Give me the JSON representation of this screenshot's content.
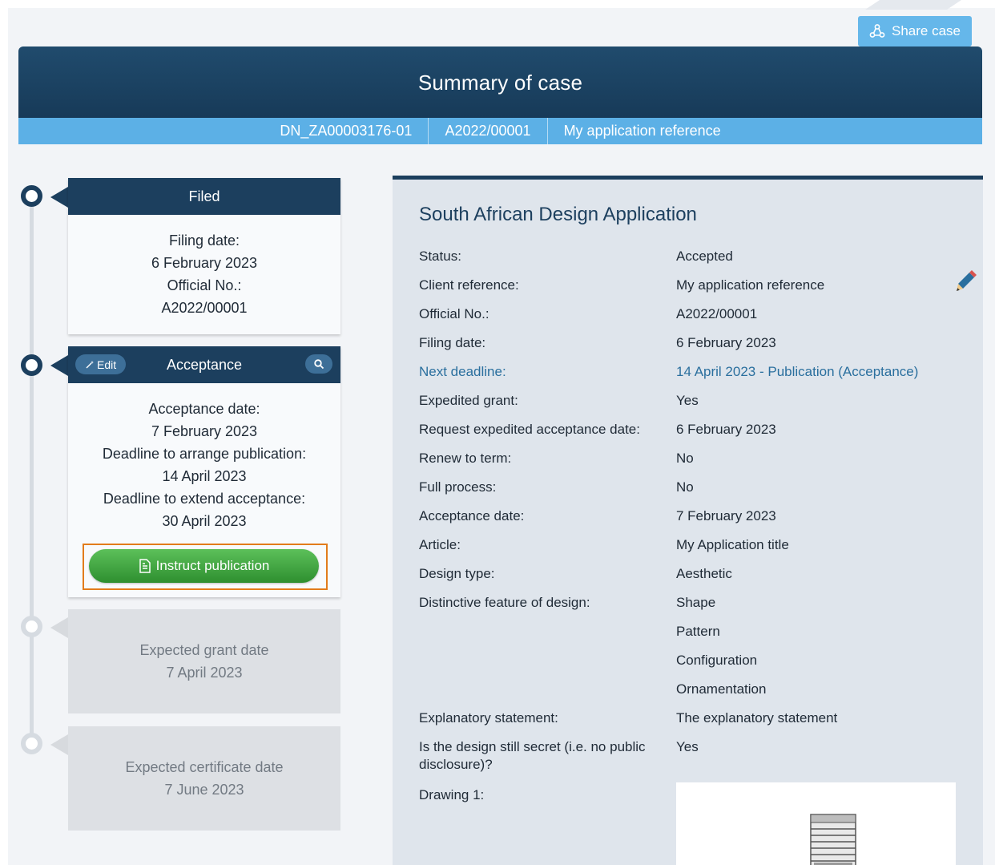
{
  "share_button": {
    "label": "Share case",
    "icon": "share-icon"
  },
  "header": {
    "title": "Summary of case",
    "strip": [
      "DN_ZA00003176-01",
      "A2022/00001",
      "My application reference"
    ]
  },
  "timeline": {
    "filed": {
      "title": "Filed",
      "lines": [
        "Filing date:",
        "6 February 2023",
        "Official No.:",
        "A2022/00001"
      ]
    },
    "acceptance": {
      "title": "Acceptance",
      "edit_label": "Edit",
      "lines": [
        "Acceptance date:",
        "7 February 2023",
        "Deadline to arrange publication:",
        "14 April 2023",
        "Deadline to extend acceptance:",
        "30 April 2023"
      ],
      "instruct_label": "Instruct publication"
    },
    "expected_grant": {
      "label": "Expected grant date",
      "date": "7 April 2023"
    },
    "expected_certificate": {
      "label": "Expected certificate date",
      "date": "7 June 2023"
    }
  },
  "details": {
    "title": "South African Design Application",
    "rows": [
      {
        "label": "Status:",
        "value": "Accepted"
      },
      {
        "label": "Client reference:",
        "value": "My application reference"
      },
      {
        "label": "Official No.:",
        "value": "A2022/00001"
      },
      {
        "label": "Filing date:",
        "value": "6 February 2023"
      },
      {
        "label": "Next deadline:",
        "value": "14 April 2023 - Publication (Acceptance)"
      },
      {
        "label": "Expedited grant:",
        "value": "Yes"
      },
      {
        "label": "Request expedited acceptance date:",
        "value": "6 February 2023"
      },
      {
        "label": "Renew to term:",
        "value": "No"
      },
      {
        "label": "Full process:",
        "value": "No"
      },
      {
        "label": "Acceptance date:",
        "value": "7 February 2023"
      },
      {
        "label": "Article:",
        "value": "My Application title"
      },
      {
        "label": "Design type:",
        "value": "Aesthetic"
      },
      {
        "label": "Distinctive feature of design:",
        "value": "Shape"
      },
      {
        "label": "",
        "value": "Pattern"
      },
      {
        "label": "",
        "value": "Configuration"
      },
      {
        "label": "",
        "value": "Ornamentation"
      },
      {
        "label": "Explanatory statement:",
        "value": "The explanatory statement"
      },
      {
        "label": "Is the design still secret (i.e. no public disclosure)?",
        "value": "Yes"
      },
      {
        "label": "Drawing 1:",
        "value": ""
      }
    ]
  }
}
